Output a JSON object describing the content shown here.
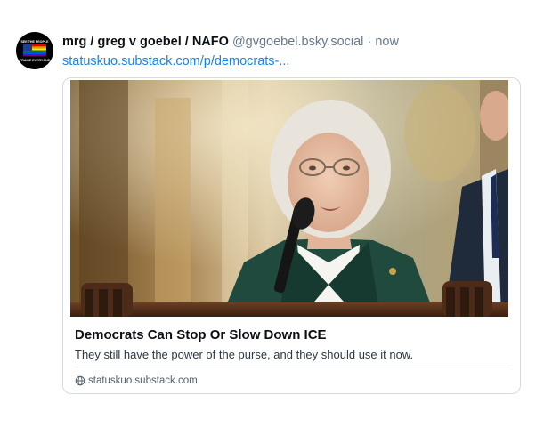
{
  "post": {
    "author": {
      "display_name": "mrg / greg v goebel / NAFO",
      "handle": "@gvgoebel.bsky.social",
      "avatar_icon": "pride-flag-avatar-icon",
      "avatar_text_top": "SEE THE PEOPLE",
      "avatar_text_bottom": "PRAISE EVERYONE"
    },
    "separator": "·",
    "timestamp": "now",
    "link_text": "statuskuo.substack.com/p/democrats-..."
  },
  "link_card": {
    "title": "Democrats Can Stop Or Slow Down ICE",
    "description": "They still have the power of the purse, and they should use it now.",
    "domain": "statuskuo.substack.com",
    "domain_icon": "globe-icon"
  },
  "colors": {
    "link": "#1083fe",
    "muted": "#66788a",
    "border": "#d4dbe2"
  }
}
